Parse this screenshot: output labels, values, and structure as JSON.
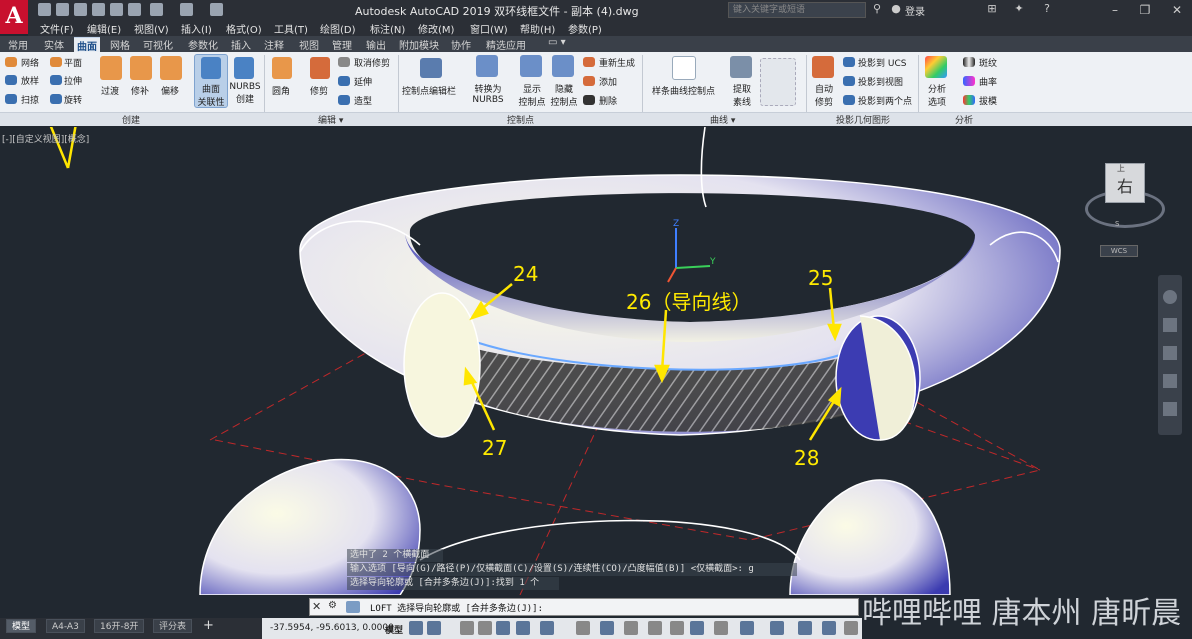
{
  "app": {
    "title": "Autodesk AutoCAD 2019    双环线框文件 - 副本 (4).dwg",
    "logo": "A"
  },
  "search": {
    "placeholder": "键入关键字或短语"
  },
  "account": {
    "login": "登录"
  },
  "menus": [
    "文件(F)",
    "编辑(E)",
    "视图(V)",
    "插入(I)",
    "格式(O)",
    "工具(T)",
    "绘图(D)",
    "标注(N)",
    "修改(M)",
    "窗口(W)",
    "帮助(H)",
    "参数(P)"
  ],
  "tabs": [
    "常用",
    "实体",
    "曲面",
    "网格",
    "可视化",
    "参数化",
    "插入",
    "注释",
    "视图",
    "管理",
    "输出",
    "附加模块",
    "协作",
    "精选应用"
  ],
  "active_tab": "曲面",
  "ribbon": {
    "create_small": [
      "网络",
      "平面",
      "放样",
      "拉伸",
      "扫掠",
      "旋转"
    ],
    "create_large": [
      "过渡",
      "修补",
      "偏移"
    ],
    "assoc": "曲面\n关联性",
    "nurbs": "NURBS\n创建",
    "fillet": "圆角",
    "trim": "修剪",
    "edit_small": [
      "取消修剪",
      "延伸",
      "造型"
    ],
    "cp_editbar": "控制点编辑栏",
    "convert": "转换为\nNURBS",
    "show_cp": "显示\n控制点",
    "hide_cp": "隐藏\n控制点",
    "cp_small": [
      "重新生成",
      "添加",
      "删除"
    ],
    "spline_cv": "样条曲线控制点",
    "extract": "提取\n素线",
    "auto_trim": "自动\n修剪",
    "proj_small": [
      "投影到 UCS",
      "投影到视图",
      "投影到两个点"
    ],
    "analysis": "分析\n选项",
    "analysis_small": [
      "斑纹",
      "曲率",
      "拔模"
    ],
    "panels": [
      "创建",
      "编辑 ▾",
      "控制点",
      "曲线 ▾",
      "投影几何图形",
      "分析"
    ]
  },
  "viewport": {
    "label": "[-][自定义视图][概念]",
    "viewcube_face": "右",
    "viewcube_top": "上",
    "compass": "WCS"
  },
  "annotations": [
    "24",
    "25",
    "26（导向线）",
    "27",
    "28"
  ],
  "command": {
    "history": [
      "选中了 2 个横截面",
      "输入选项 [导向(G)/路径(P)/仅横截面(C)/设置(S)/连续性(CO)/凸度幅值(B)] <仅横截面>: g",
      "选择导向轮廓或 [合并多条边(J)]:找到 1 个"
    ],
    "prompt": "LOFT 选择导向轮廓或 [合并多条边(J)]:"
  },
  "layout_tabs": [
    "模型",
    "A4-A3",
    "16开-8开",
    "评分表"
  ],
  "status": {
    "coords": "-37.5954, -95.6013, 0.0000",
    "model": "模型"
  },
  "watermark": "哔哩哔哩 唐本州  唐昕晨"
}
